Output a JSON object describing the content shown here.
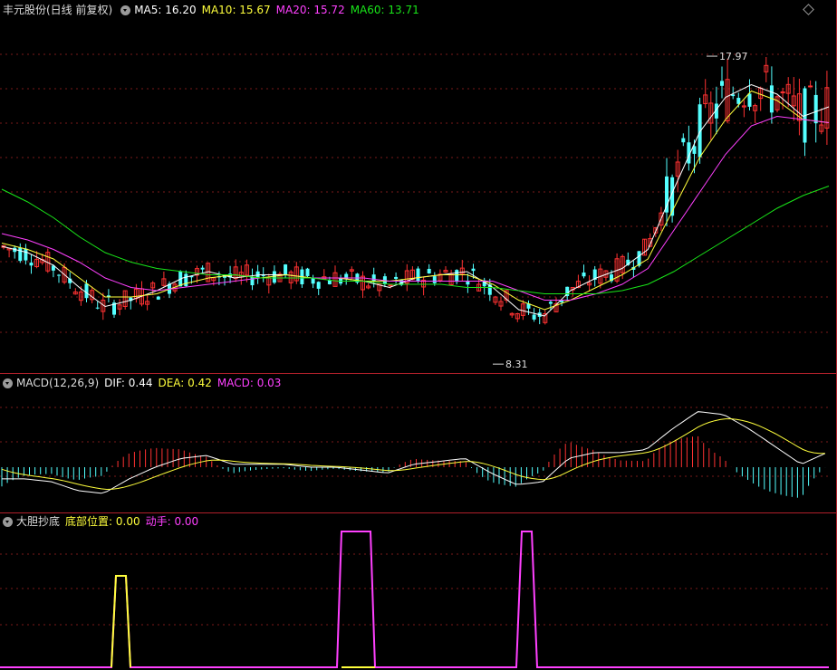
{
  "main_panel": {
    "stock_label": "丰元股份(日线 前复权)",
    "ma5_label": "MA5: 16.20",
    "ma10_label": "MA10: 15.67",
    "ma20_label": "MA20: 15.72",
    "ma60_label": "MA60: 13.71",
    "high_label": "17.97",
    "low_label": "8.31",
    "colors": {
      "up": "#ff3232",
      "down": "#54ffff",
      "ma5": "#ffffff",
      "ma10": "#ffff3c",
      "ma20": "#ff40ff",
      "ma60": "#19e519"
    }
  },
  "macd_panel": {
    "title": "MACD(12,26,9)",
    "dif_label": "DIF: 0.44",
    "dea_label": "DEA: 0.42",
    "macd_label": "MACD: 0.03"
  },
  "indicator_panel": {
    "title": "大胆抄底",
    "bottom_label": "底部位置: 0.00",
    "action_label": "动手: 0.00"
  },
  "icons": {
    "dropdown": "chevron-down-icon",
    "expand": "diamond-expand-icon"
  },
  "chart_data": {
    "type": "line",
    "series": [
      {
        "name": "MA5",
        "values": [
          11.8,
          11.6,
          11.2,
          10.5,
          9.9,
          10.1,
          10.4,
          10.8,
          11.0,
          10.8,
          10.9,
          10.9,
          10.8,
          10.8,
          10.7,
          10.5,
          10.8,
          10.9,
          11.0,
          10.5,
          9.8,
          9.6,
          10.4,
          10.8,
          11.1,
          11.7,
          13.6,
          15.4,
          16.5,
          16.9,
          16.6,
          15.9,
          16.2
        ]
      },
      {
        "name": "MA10",
        "values": [
          11.9,
          11.7,
          11.4,
          10.8,
          10.2,
          10.2,
          10.3,
          10.6,
          10.8,
          10.9,
          10.8,
          10.9,
          10.8,
          10.8,
          10.7,
          10.7,
          10.8,
          10.9,
          10.9,
          10.6,
          10.1,
          9.8,
          10.1,
          10.5,
          10.9,
          11.4,
          13.0,
          14.6,
          15.8,
          16.7,
          16.4,
          15.8,
          15.7
        ]
      },
      {
        "name": "MA20",
        "values": [
          12.2,
          12.0,
          11.7,
          11.3,
          10.8,
          10.5,
          10.4,
          10.5,
          10.6,
          10.7,
          10.8,
          10.8,
          10.8,
          10.8,
          10.8,
          10.7,
          10.7,
          10.7,
          10.7,
          10.7,
          10.4,
          10.1,
          10.1,
          10.3,
          10.6,
          11.1,
          12.3,
          13.5,
          14.7,
          15.6,
          15.9,
          15.8,
          15.7
        ]
      },
      {
        "name": "MA60",
        "values": [
          13.6,
          13.2,
          12.7,
          12.1,
          11.6,
          11.3,
          11.1,
          11.0,
          10.9,
          10.9,
          10.8,
          10.8,
          10.8,
          10.7,
          10.7,
          10.6,
          10.6,
          10.6,
          10.5,
          10.5,
          10.4,
          10.3,
          10.3,
          10.3,
          10.4,
          10.6,
          11.0,
          11.5,
          12.0,
          12.5,
          13.0,
          13.4,
          13.7
        ]
      }
    ],
    "ylim": [
      8.0,
      19.0
    ],
    "macd_ylim": [
      -1.2,
      2.2
    ],
    "extremes": {
      "high": 17.97,
      "low": 8.31
    }
  }
}
